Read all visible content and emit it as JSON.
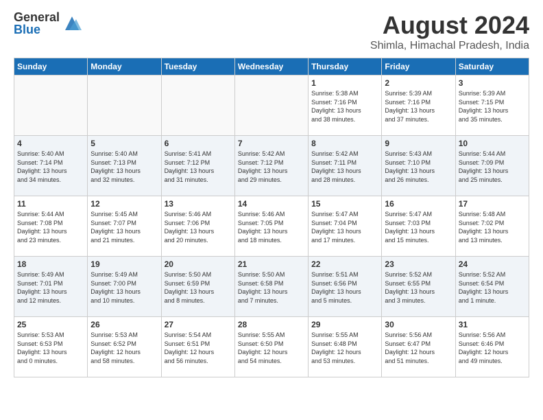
{
  "header": {
    "logo_general": "General",
    "logo_blue": "Blue",
    "month_year": "August 2024",
    "location": "Shimla, Himachal Pradesh, India"
  },
  "weekdays": [
    "Sunday",
    "Monday",
    "Tuesday",
    "Wednesday",
    "Thursday",
    "Friday",
    "Saturday"
  ],
  "weeks": [
    [
      {
        "day": "",
        "info": ""
      },
      {
        "day": "",
        "info": ""
      },
      {
        "day": "",
        "info": ""
      },
      {
        "day": "",
        "info": ""
      },
      {
        "day": "1",
        "info": "Sunrise: 5:38 AM\nSunset: 7:16 PM\nDaylight: 13 hours\nand 38 minutes."
      },
      {
        "day": "2",
        "info": "Sunrise: 5:39 AM\nSunset: 7:16 PM\nDaylight: 13 hours\nand 37 minutes."
      },
      {
        "day": "3",
        "info": "Sunrise: 5:39 AM\nSunset: 7:15 PM\nDaylight: 13 hours\nand 35 minutes."
      }
    ],
    [
      {
        "day": "4",
        "info": "Sunrise: 5:40 AM\nSunset: 7:14 PM\nDaylight: 13 hours\nand 34 minutes."
      },
      {
        "day": "5",
        "info": "Sunrise: 5:40 AM\nSunset: 7:13 PM\nDaylight: 13 hours\nand 32 minutes."
      },
      {
        "day": "6",
        "info": "Sunrise: 5:41 AM\nSunset: 7:12 PM\nDaylight: 13 hours\nand 31 minutes."
      },
      {
        "day": "7",
        "info": "Sunrise: 5:42 AM\nSunset: 7:12 PM\nDaylight: 13 hours\nand 29 minutes."
      },
      {
        "day": "8",
        "info": "Sunrise: 5:42 AM\nSunset: 7:11 PM\nDaylight: 13 hours\nand 28 minutes."
      },
      {
        "day": "9",
        "info": "Sunrise: 5:43 AM\nSunset: 7:10 PM\nDaylight: 13 hours\nand 26 minutes."
      },
      {
        "day": "10",
        "info": "Sunrise: 5:44 AM\nSunset: 7:09 PM\nDaylight: 13 hours\nand 25 minutes."
      }
    ],
    [
      {
        "day": "11",
        "info": "Sunrise: 5:44 AM\nSunset: 7:08 PM\nDaylight: 13 hours\nand 23 minutes."
      },
      {
        "day": "12",
        "info": "Sunrise: 5:45 AM\nSunset: 7:07 PM\nDaylight: 13 hours\nand 21 minutes."
      },
      {
        "day": "13",
        "info": "Sunrise: 5:46 AM\nSunset: 7:06 PM\nDaylight: 13 hours\nand 20 minutes."
      },
      {
        "day": "14",
        "info": "Sunrise: 5:46 AM\nSunset: 7:05 PM\nDaylight: 13 hours\nand 18 minutes."
      },
      {
        "day": "15",
        "info": "Sunrise: 5:47 AM\nSunset: 7:04 PM\nDaylight: 13 hours\nand 17 minutes."
      },
      {
        "day": "16",
        "info": "Sunrise: 5:47 AM\nSunset: 7:03 PM\nDaylight: 13 hours\nand 15 minutes."
      },
      {
        "day": "17",
        "info": "Sunrise: 5:48 AM\nSunset: 7:02 PM\nDaylight: 13 hours\nand 13 minutes."
      }
    ],
    [
      {
        "day": "18",
        "info": "Sunrise: 5:49 AM\nSunset: 7:01 PM\nDaylight: 13 hours\nand 12 minutes."
      },
      {
        "day": "19",
        "info": "Sunrise: 5:49 AM\nSunset: 7:00 PM\nDaylight: 13 hours\nand 10 minutes."
      },
      {
        "day": "20",
        "info": "Sunrise: 5:50 AM\nSunset: 6:59 PM\nDaylight: 13 hours\nand 8 minutes."
      },
      {
        "day": "21",
        "info": "Sunrise: 5:50 AM\nSunset: 6:58 PM\nDaylight: 13 hours\nand 7 minutes."
      },
      {
        "day": "22",
        "info": "Sunrise: 5:51 AM\nSunset: 6:56 PM\nDaylight: 13 hours\nand 5 minutes."
      },
      {
        "day": "23",
        "info": "Sunrise: 5:52 AM\nSunset: 6:55 PM\nDaylight: 13 hours\nand 3 minutes."
      },
      {
        "day": "24",
        "info": "Sunrise: 5:52 AM\nSunset: 6:54 PM\nDaylight: 13 hours\nand 1 minute."
      }
    ],
    [
      {
        "day": "25",
        "info": "Sunrise: 5:53 AM\nSunset: 6:53 PM\nDaylight: 13 hours\nand 0 minutes."
      },
      {
        "day": "26",
        "info": "Sunrise: 5:53 AM\nSunset: 6:52 PM\nDaylight: 12 hours\nand 58 minutes."
      },
      {
        "day": "27",
        "info": "Sunrise: 5:54 AM\nSunset: 6:51 PM\nDaylight: 12 hours\nand 56 minutes."
      },
      {
        "day": "28",
        "info": "Sunrise: 5:55 AM\nSunset: 6:50 PM\nDaylight: 12 hours\nand 54 minutes."
      },
      {
        "day": "29",
        "info": "Sunrise: 5:55 AM\nSunset: 6:48 PM\nDaylight: 12 hours\nand 53 minutes."
      },
      {
        "day": "30",
        "info": "Sunrise: 5:56 AM\nSunset: 6:47 PM\nDaylight: 12 hours\nand 51 minutes."
      },
      {
        "day": "31",
        "info": "Sunrise: 5:56 AM\nSunset: 6:46 PM\nDaylight: 12 hours\nand 49 minutes."
      }
    ]
  ]
}
